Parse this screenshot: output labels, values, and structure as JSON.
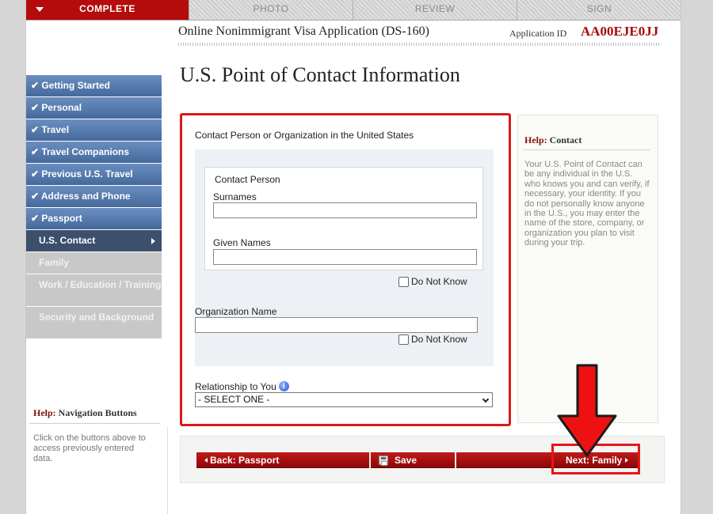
{
  "tabs": {
    "complete": "COMPLETE",
    "photo": "PHOTO",
    "review": "REVIEW",
    "sign": "SIGN"
  },
  "header": {
    "app_title": "Online Nonimmigrant Visa Application (DS-160)",
    "app_id_label": "Application ID",
    "app_id_value": "AA00EJE0JJ"
  },
  "sidebar": {
    "items": [
      {
        "label": "Getting Started",
        "state": "done"
      },
      {
        "label": "Personal",
        "state": "done"
      },
      {
        "label": "Travel",
        "state": "done"
      },
      {
        "label": "Travel Companions",
        "state": "done"
      },
      {
        "label": "Previous U.S. Travel",
        "state": "done"
      },
      {
        "label": "Address and Phone",
        "state": "done"
      },
      {
        "label": "Passport",
        "state": "done"
      },
      {
        "label": "U.S. Contact",
        "state": "current"
      },
      {
        "label": "Family",
        "state": "todo"
      },
      {
        "label": "Work / Education / Training",
        "state": "todo"
      },
      {
        "label": "Security and Background",
        "state": "todo"
      }
    ],
    "help_title_strong": "Help:",
    "help_title_rest": "Navigation Buttons",
    "help_text": "Click on the buttons above to access previously entered data."
  },
  "page": {
    "title": "U.S. Point of Contact Information"
  },
  "form": {
    "main_label": "Contact Person or Organization in the United States",
    "contact_person_label": "Contact Person",
    "surnames_label": "Surnames",
    "surnames_value": "",
    "given_names_label": "Given Names",
    "given_names_value": "",
    "do_not_know_label": "Do Not Know",
    "organization_label": "Organization Name",
    "organization_value": "",
    "relationship_label": "Relationship to You",
    "relationship_selected": "- SELECT ONE -"
  },
  "help_panel": {
    "title_strong": "Help:",
    "title_rest": "Contact",
    "text": "Your U.S. Point of Contact can be any individual in the U.S. who knows you and can verify, if necessary, your identity. If you do not personally know anyone in the U.S., you may enter the name of the store, company, or organization you plan to visit during your trip."
  },
  "buttons": {
    "back": "Back: Passport",
    "save": "Save",
    "next": "Next: Family"
  },
  "colors": {
    "accent_red": "#b40c0c",
    "nav_blue": "#46699c",
    "nav_current": "#3c4f6c",
    "annotation_red": "#e51616"
  }
}
